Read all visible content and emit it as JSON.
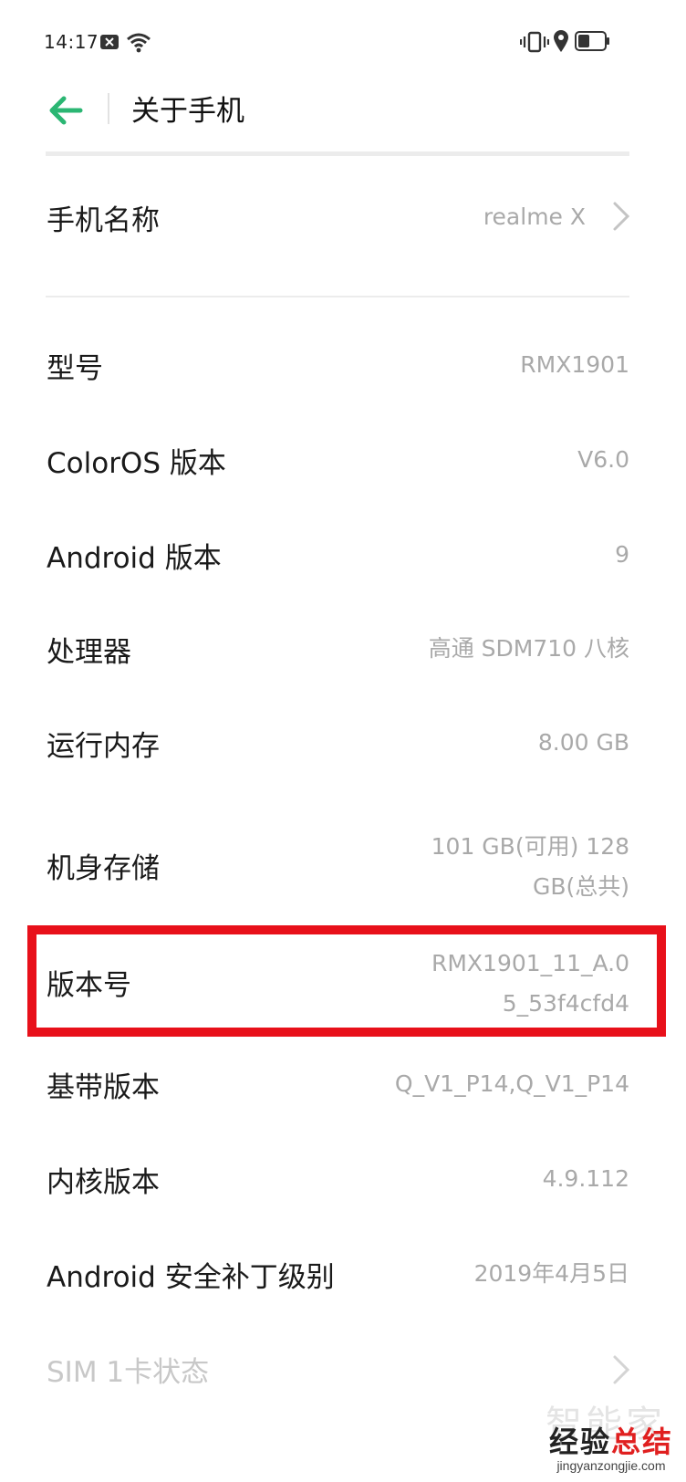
{
  "status_bar": {
    "time": "14:17",
    "icons": [
      "notification-icon",
      "wifi-icon",
      "vibrate-icon",
      "location-icon",
      "battery-icon"
    ]
  },
  "header": {
    "back_icon": "back-arrow-icon",
    "title": "关于手机"
  },
  "device_name": {
    "label": "手机名称",
    "value": "realme X"
  },
  "info_rows": [
    {
      "label": "型号",
      "value": "RMX1901"
    },
    {
      "label": "ColorOS 版本",
      "value": "V6.0"
    },
    {
      "label": "Android 版本",
      "value": "9"
    },
    {
      "label": "处理器",
      "value": "高通 SDM710 八核"
    },
    {
      "label": "运行内存",
      "value": "8.00 GB"
    },
    {
      "label": "机身存储",
      "value": "101 GB(可用) 128 GB(总共)"
    },
    {
      "label": "版本号",
      "value": "RMX1901_11_A.05_53f4cfd4"
    },
    {
      "label": "基带版本",
      "value": "Q_V1_P14,Q_V1_P14"
    },
    {
      "label": "内核版本",
      "value": "4.9.112"
    },
    {
      "label": "Android 安全补丁级别",
      "value": "2019年4月5日"
    }
  ],
  "sim_row": {
    "label": "SIM 1卡状态"
  },
  "watermark": {
    "brand_part1": "经验",
    "brand_part2": "总结",
    "url": "jingyanzongjie.com",
    "faded": "智能家"
  },
  "colors": {
    "accent_green": "#2bb673",
    "highlight_red": "#e8101a",
    "value_gray": "#a9a9a9"
  }
}
